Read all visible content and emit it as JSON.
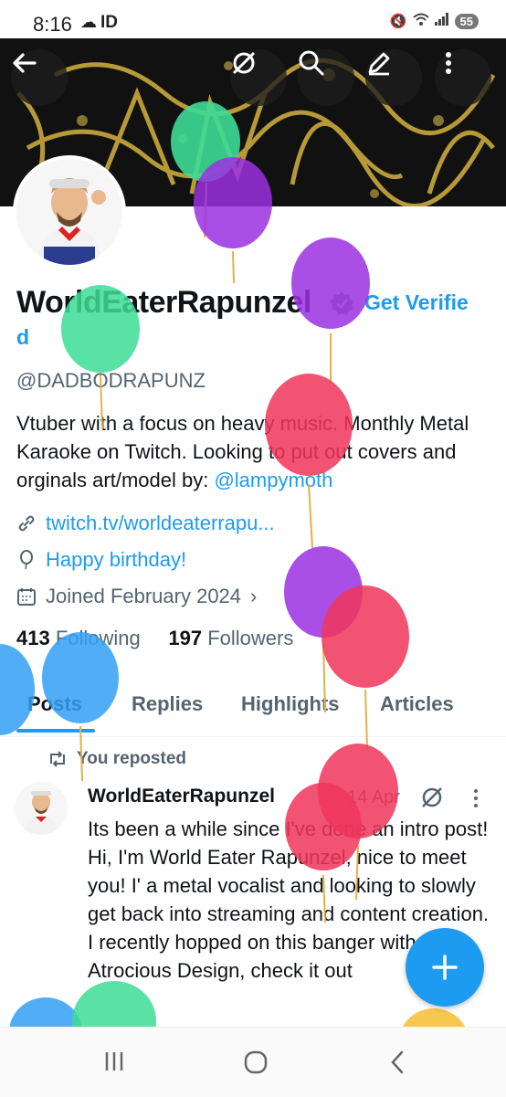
{
  "status_bar": {
    "time": "8:16",
    "carrier": "ID",
    "battery": "55"
  },
  "profile": {
    "name": "WorldEaterRapunzel",
    "get_verified_line1": "Get Verifie",
    "get_verified_line2": "d",
    "handle": "@DADBODRAPUNZ",
    "bio_text": "Vtuber with a focus on heavy music. Monthly Metal Karaoke on Twitch. Looking to put out covers and orginals  art/model by: ",
    "bio_mention": "@lampymoth",
    "website": "twitch.tv/worldeaterrapu...",
    "birthday": "Happy birthday!",
    "joined": "Joined February 2024",
    "following_count": "413",
    "following_label": "Following",
    "followers_count": "197",
    "followers_label": "Followers"
  },
  "tabs": [
    "Posts",
    "Replies",
    "Highlights",
    "Articles"
  ],
  "tweet": {
    "repost_label": "You reposted",
    "author": "WorldEaterRapunzel",
    "date": "14 Apr",
    "body": "Its been a while since I've done an intro post! Hi, I'm World Eater Rapunzel, nice to meet you! I' a metal vocalist and looking to slowly get back into streaming and content creation. I recently hopped on this banger with Atrocious Design, check it out"
  },
  "icons": {
    "back": "back-arrow-icon",
    "grok": "grok-icon",
    "search": "search-icon",
    "edit": "edit-icon",
    "more": "more-vertical-icon",
    "link": "link-icon",
    "birthday": "balloon-icon",
    "calendar": "calendar-icon",
    "repost": "repost-icon",
    "compose": "plus-icon"
  },
  "colors": {
    "accent": "#1d9bf0",
    "text": "#0f1419",
    "muted": "#536471"
  }
}
